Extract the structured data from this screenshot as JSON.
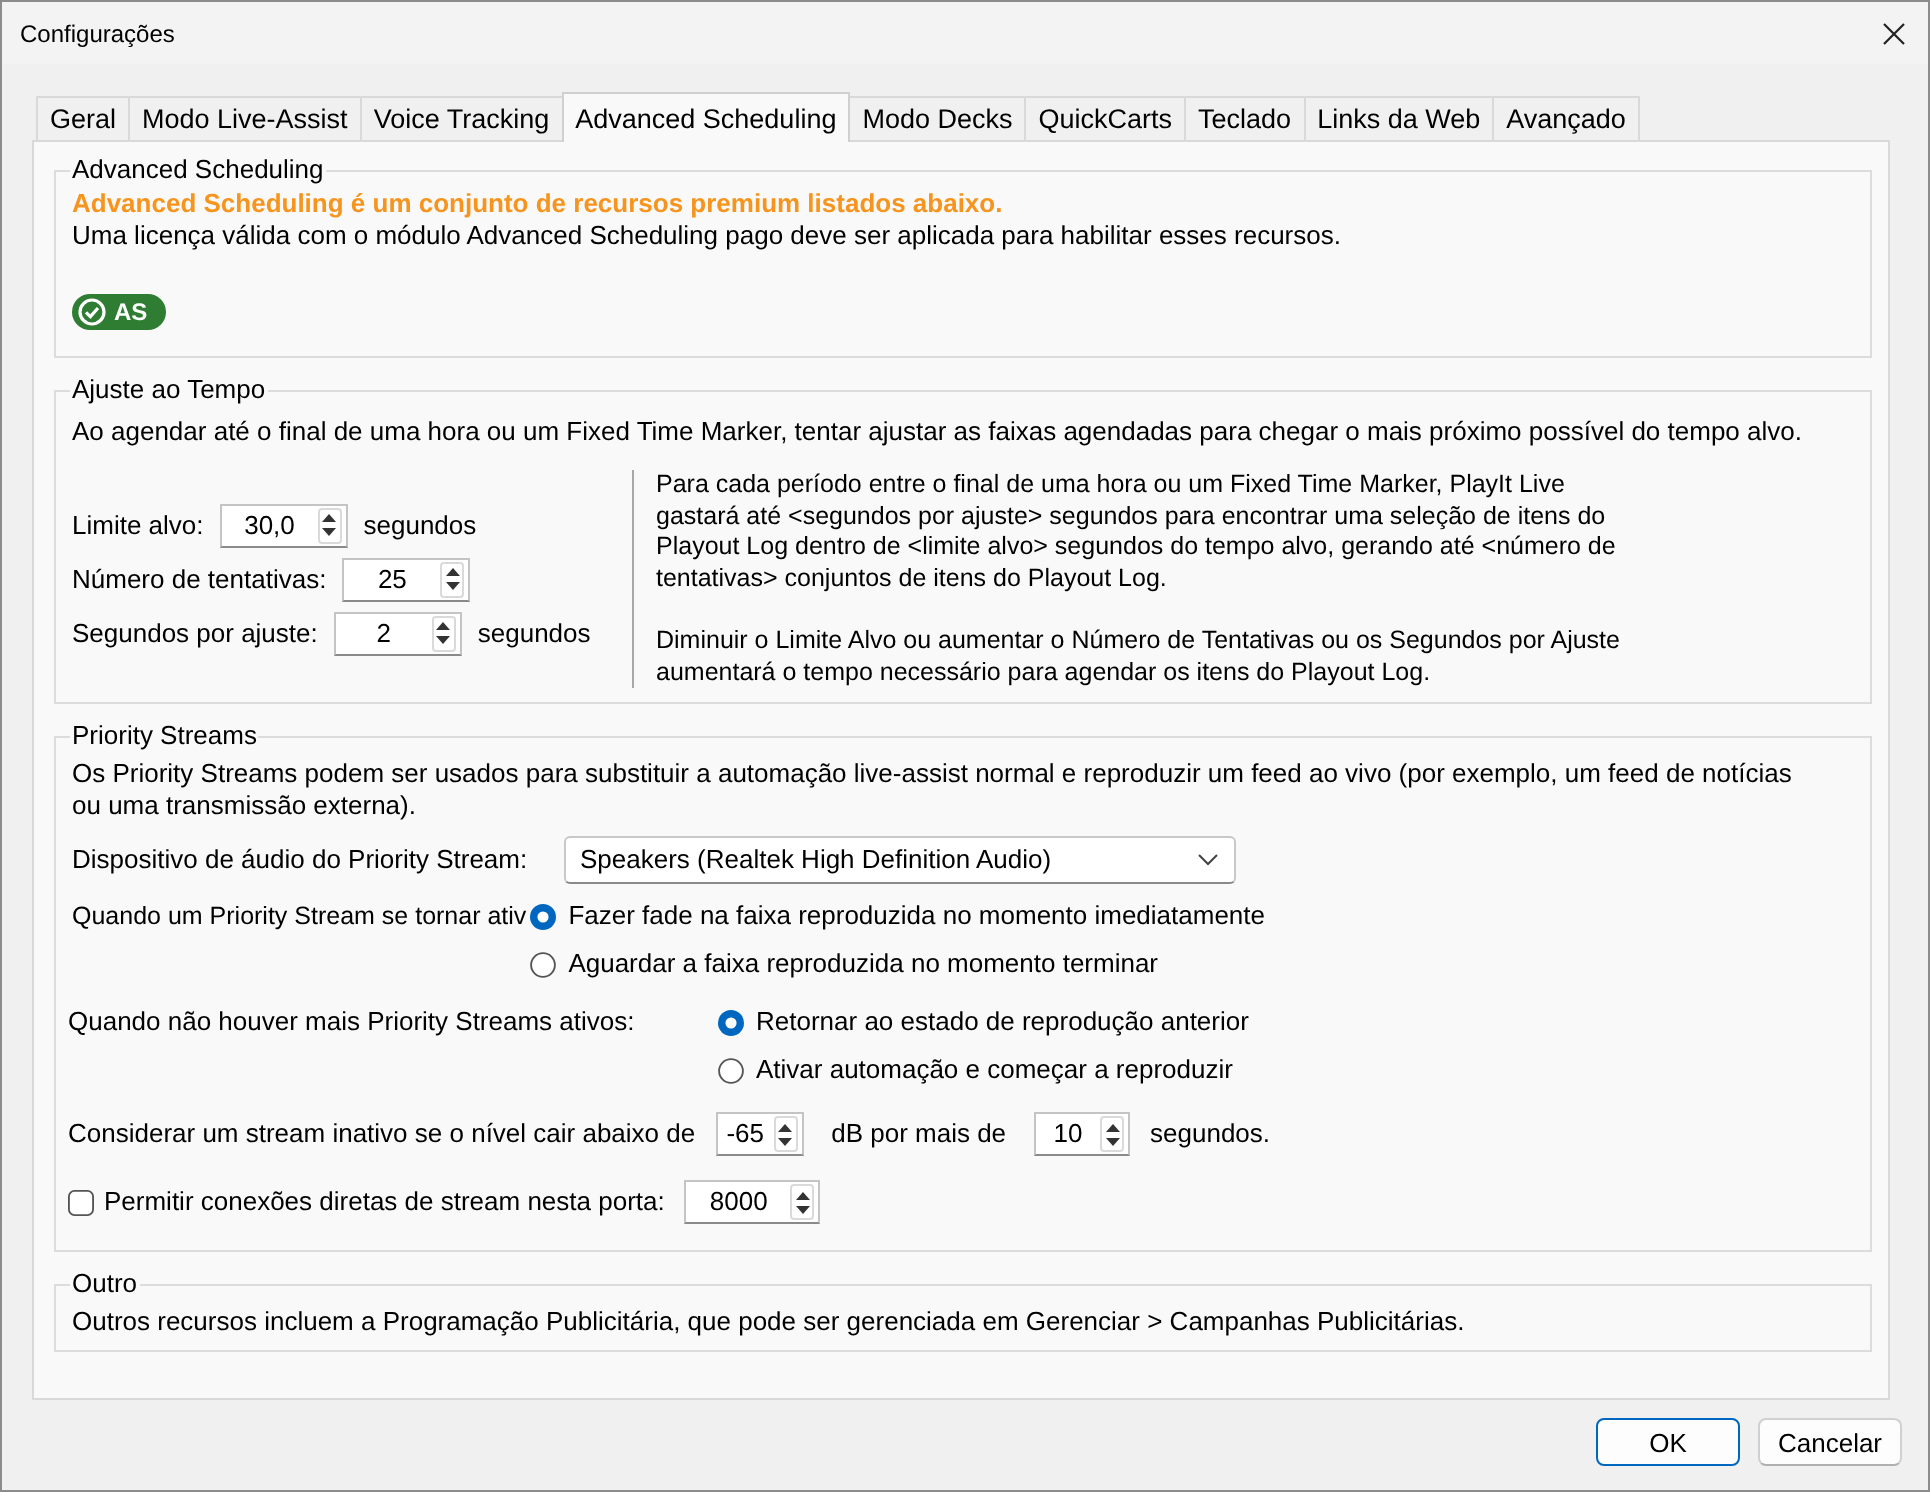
{
  "window": {
    "title": "Configurações"
  },
  "tabs": [
    {
      "label": "Geral",
      "selected": false
    },
    {
      "label": "Modo Live-Assist",
      "selected": false
    },
    {
      "label": "Voice Tracking",
      "selected": false
    },
    {
      "label": "Advanced Scheduling",
      "selected": true
    },
    {
      "label": "Modo Decks",
      "selected": false
    },
    {
      "label": "QuickCarts",
      "selected": false
    },
    {
      "label": "Teclado",
      "selected": false
    },
    {
      "label": "Links da Web",
      "selected": false
    },
    {
      "label": "Avançado",
      "selected": false
    }
  ],
  "advanced_scheduling": {
    "title": "Advanced Scheduling",
    "headline": "Advanced Scheduling é um conjunto de recursos premium listados abaixo.",
    "description": "Uma licença válida com o módulo Advanced Scheduling pago deve ser aplicada para habilitar esses recursos.",
    "badge": {
      "label": "AS"
    }
  },
  "time_fit": {
    "title": "Ajuste ao Tempo",
    "description": "Ao agendar até o final de uma hora ou um Fixed Time Marker, tentar ajustar as faixas agendadas para chegar o mais próximo possível do tempo alvo.",
    "fields": [
      {
        "label": "Limite alvo:",
        "value": "30,0",
        "unit": "segundos"
      },
      {
        "label": "Número de tentativas:",
        "value": "25"
      },
      {
        "label": "Segundos por ajuste:",
        "value": "2",
        "unit": "segundos"
      }
    ],
    "help": [
      "Para cada período entre o final de uma hora ou um Fixed Time Marker, PlayIt Live gastará até <segundos por ajuste> segundos para encontrar uma seleção de itens do Playout Log dentro de <limite alvo> segundos do tempo alvo, gerando até <número de tentativas> conjuntos de itens do Playout Log.",
      "Diminuir o Limite Alvo ou aumentar o Número de Tentativas ou os Segundos por Ajuste aumentará o tempo necessário para agendar os itens do Playout Log."
    ]
  },
  "priority_streams": {
    "title": "Priority Streams",
    "description": "Os Priority Streams podem ser usados para substituir a automação live-assist normal e reproduzir um feed ao vivo (por exemplo, um feed de notícias ou uma transmissão externa).",
    "device": {
      "label": "Dispositivo de áudio do Priority Stream:",
      "value": "Speakers (Realtek High Definition Audio)"
    },
    "radio_groups": [
      {
        "label": "Quando um Priority Stream se tornar ativ",
        "options": [
          {
            "label": "Fazer fade na faixa reproduzida no momento imediatamente",
            "selected": true
          },
          {
            "label": "Aguardar a faixa reproduzida no momento terminar",
            "selected": false
          }
        ]
      },
      {
        "label": "Quando não houver mais Priority Streams ativos:",
        "options": [
          {
            "label": "Retornar ao estado de reprodução anterior",
            "selected": true
          },
          {
            "label": "Ativar automação e começar a reproduzir",
            "selected": false
          }
        ]
      }
    ],
    "inactive": {
      "label": "Considerar um stream inativo se o nível cair abaixo de",
      "threshold": "-65",
      "middle": "dB por mais de",
      "duration": "10",
      "unit": "segundos."
    },
    "direct": {
      "label": "Permitir conexões diretas de stream nesta porta:",
      "checked": false,
      "port": "8000"
    }
  },
  "other": {
    "title": "Outro",
    "text": "Outros recursos incluem a Programação Publicitária, que pode ser gerenciada em Gerenciar > Campanhas Publicitárias."
  },
  "buttons": [
    {
      "label": "OK",
      "default": true
    },
    {
      "label": "Cancelar",
      "default": false
    }
  ]
}
